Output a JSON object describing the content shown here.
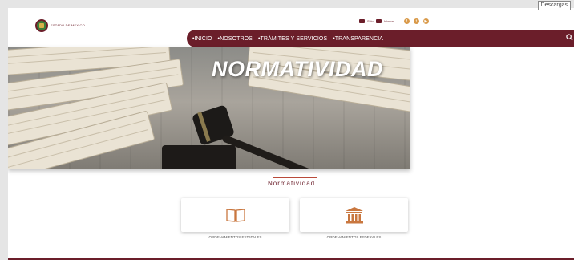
{
  "header": {
    "download_button": "Descargas",
    "logo_text": "ESTADO DE MEXICO",
    "top_links": [
      "Sitio",
      "Idioma"
    ],
    "social_icons": [
      "facebook-icon",
      "twitter-icon",
      "youtube-icon"
    ]
  },
  "nav": {
    "items": [
      "•INICIO",
      "•NOSOTROS",
      "•TRÁMITES Y SERVICIOS",
      "•TRANSPARENCIA"
    ]
  },
  "hero": {
    "title": "NORMATIVIDAD"
  },
  "section": {
    "title": "Normatividad"
  },
  "cards": [
    {
      "label": "ORDENAMIENTOS ESTATALES",
      "icon": "open-book-icon"
    },
    {
      "label": "ORDENAMIENTOS FEDERALES",
      "icon": "institution-building-icon"
    }
  ],
  "colors": {
    "primary": "#6b1e2a",
    "accent": "#b94a3a",
    "icon": "#c9773f"
  }
}
